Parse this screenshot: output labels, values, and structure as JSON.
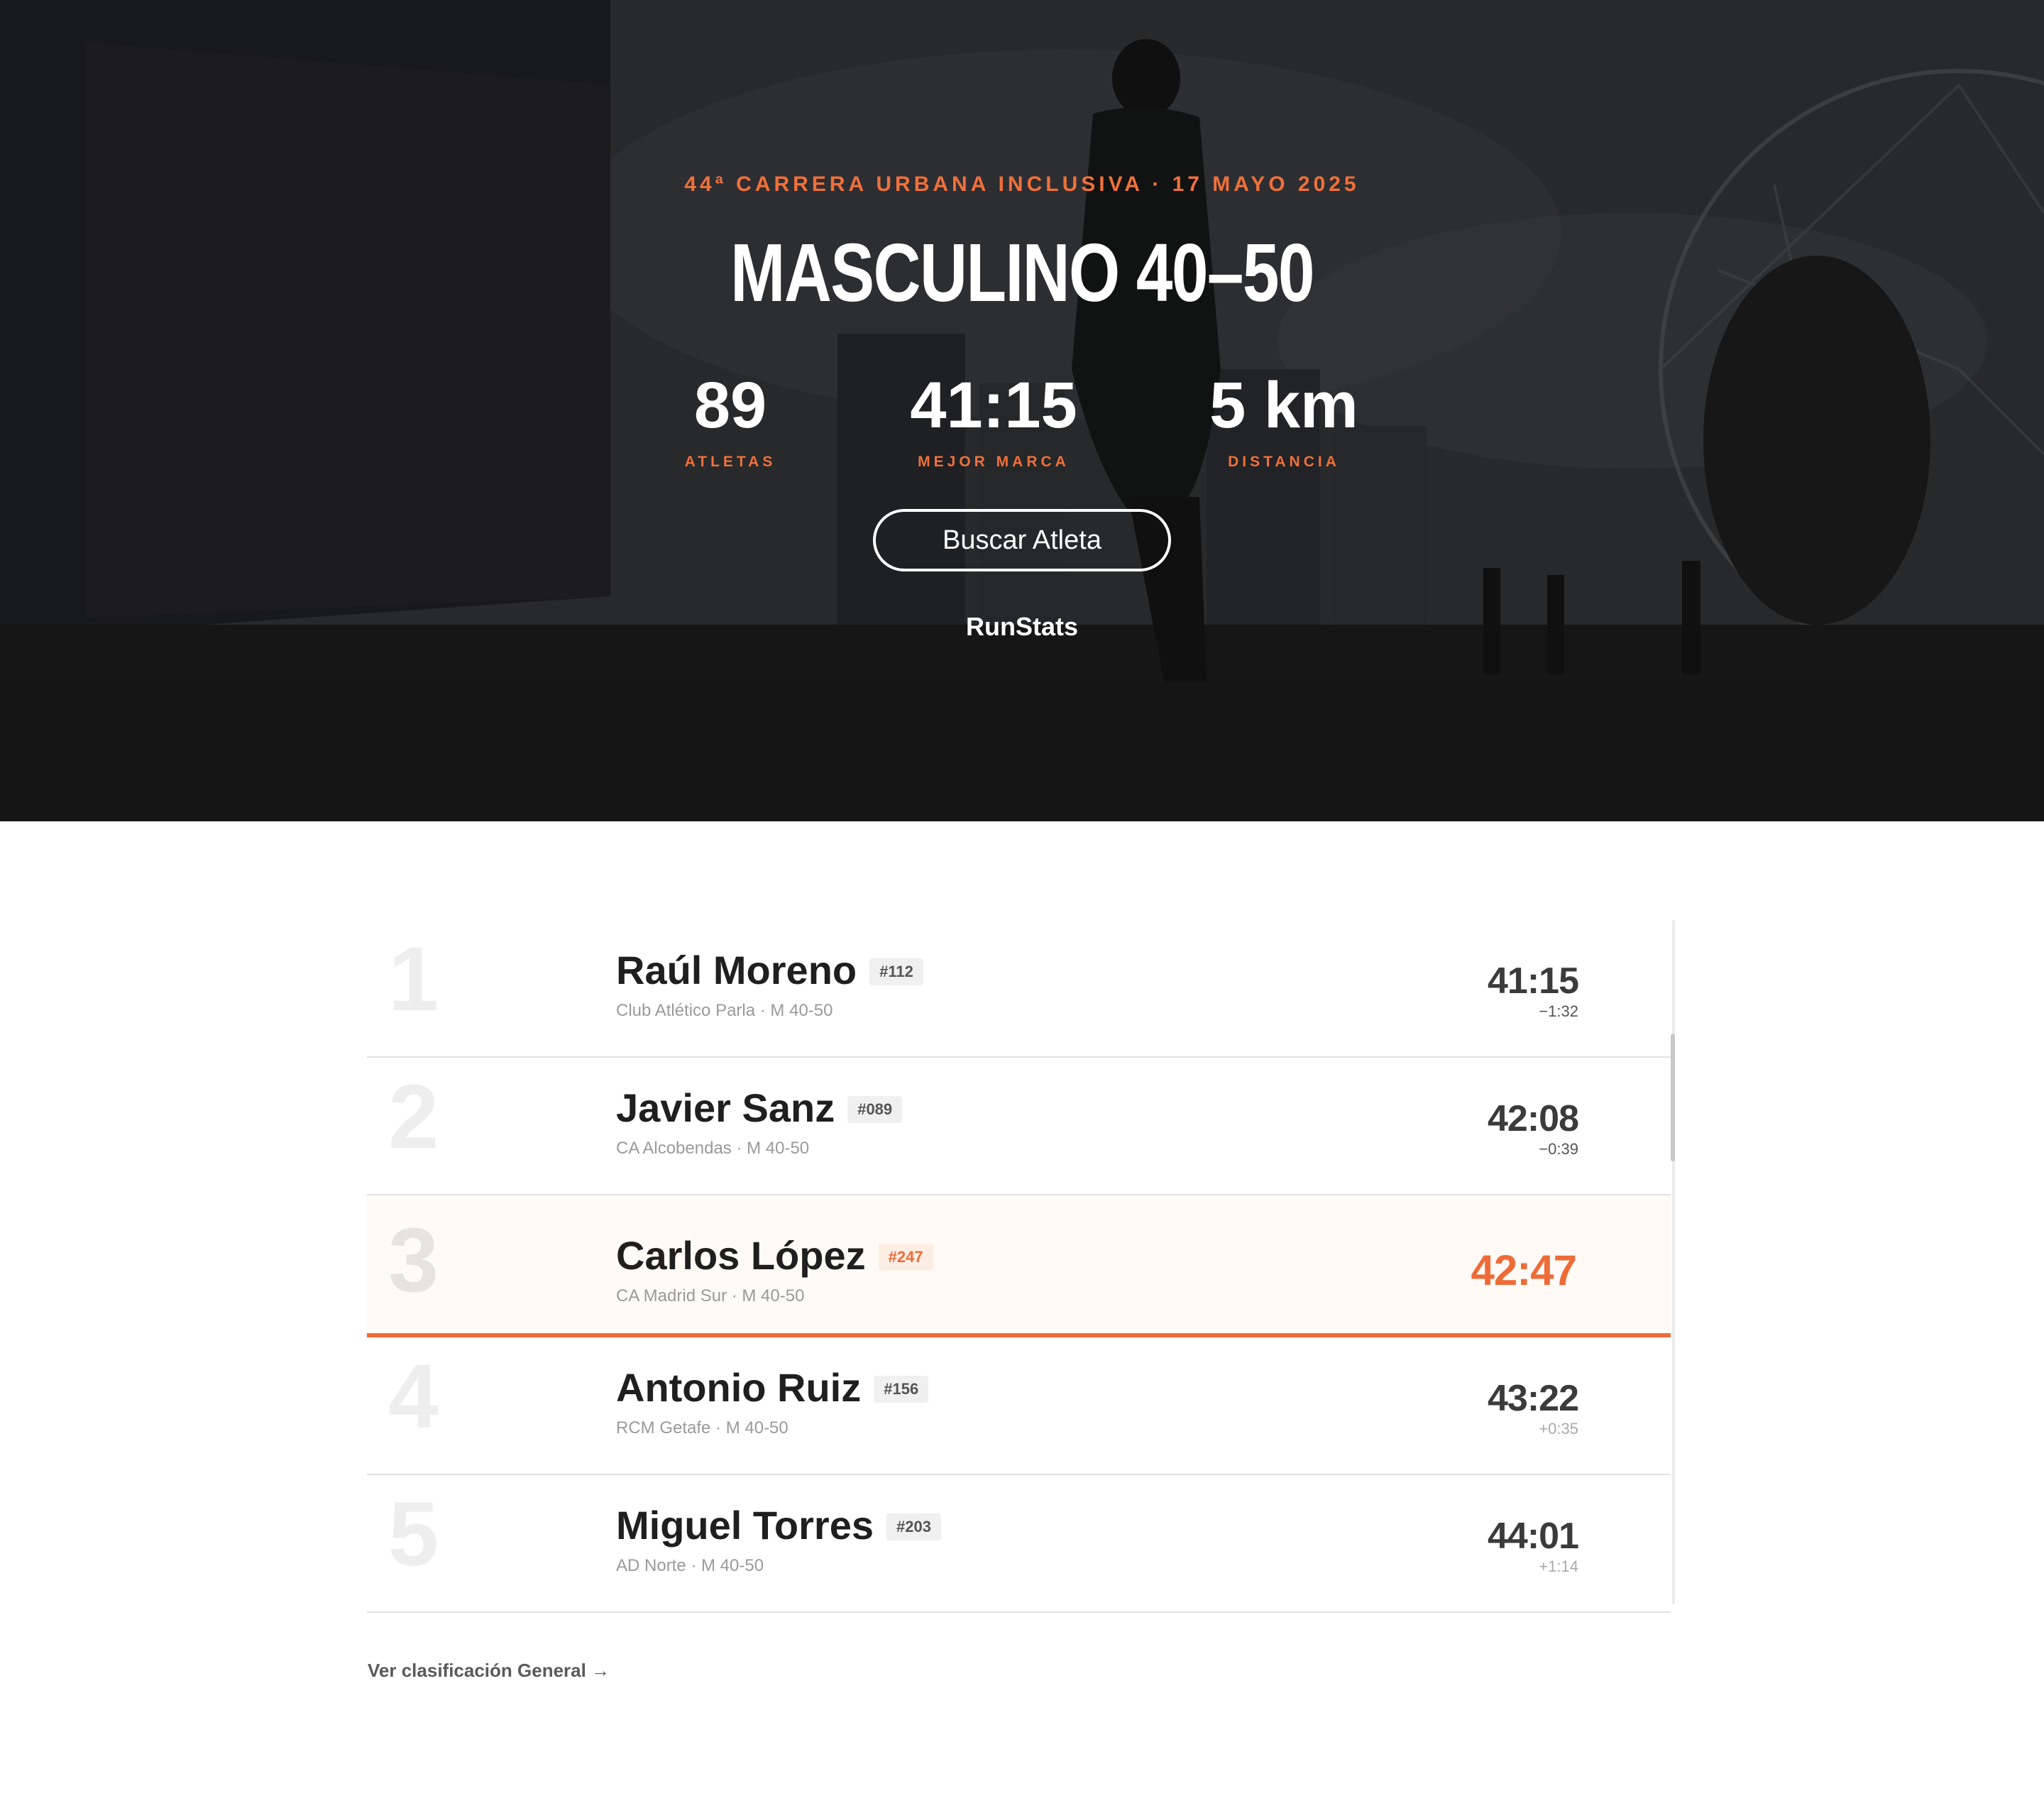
{
  "hero": {
    "eyebrow": "44ª CARRERA URBANA INCLUSIVA · 17 MAYO 2025",
    "title": "MASCULINO 40–50",
    "stats": [
      {
        "value": "89",
        "label": "ATLETAS"
      },
      {
        "value": "41:15",
        "label": "MEJOR MARCA"
      },
      {
        "value": "5 km",
        "label": "DISTANCIA"
      }
    ],
    "search_label": "Buscar Atleta",
    "brand": "RunStats"
  },
  "results": [
    {
      "rank": "1",
      "name": "Raúl Moreno",
      "bib": "#112",
      "club": "Club Atlético Parla · M 40-50",
      "time": "41:15",
      "diff": "−1:32",
      "diff_sign": "minus",
      "highlight": false
    },
    {
      "rank": "2",
      "name": "Javier Sanz",
      "bib": "#089",
      "club": "CA Alcobendas · M 40-50",
      "time": "42:08",
      "diff": "−0:39",
      "diff_sign": "minus",
      "highlight": false
    },
    {
      "rank": "3",
      "name": "Carlos López",
      "bib": "#247",
      "club": "CA Madrid Sur · M 40-50",
      "time": "42:47",
      "diff": "",
      "diff_sign": "none",
      "highlight": true
    },
    {
      "rank": "4",
      "name": "Antonio Ruiz",
      "bib": "#156",
      "club": "RCM Getafe · M 40-50",
      "time": "43:22",
      "diff": "+0:35",
      "diff_sign": "plus",
      "highlight": false
    },
    {
      "rank": "5",
      "name": "Miguel Torres",
      "bib": "#203",
      "club": "AD Norte · M 40-50",
      "time": "44:01",
      "diff": "+1:14",
      "diff_sign": "plus",
      "highlight": false
    }
  ],
  "footer": {
    "general_link": "Ver clasificación General →"
  },
  "colors": {
    "accent": "#ee6b38",
    "hero_text": "#ffffff"
  }
}
